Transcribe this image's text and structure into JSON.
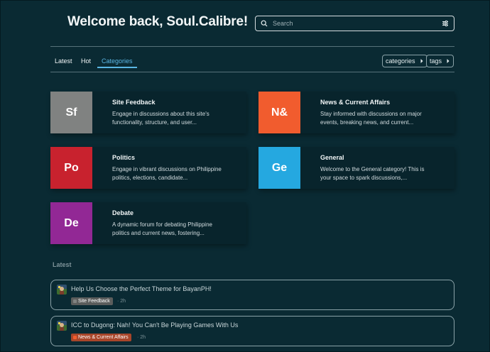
{
  "header": {
    "welcome": "Welcome back, Soul.Calibre!",
    "search_placeholder": "Search"
  },
  "nav": {
    "tabs": [
      {
        "label": "Latest",
        "active": false
      },
      {
        "label": "Hot",
        "active": false
      },
      {
        "label": "Categories",
        "active": true
      }
    ],
    "dropdowns": [
      {
        "label": "categories"
      },
      {
        "label": "tags"
      }
    ]
  },
  "categories": [
    {
      "abbr": "Sf",
      "name": "Site Feedback",
      "color": "#808281",
      "desc": "Engage in discussions about this site's functionality, structure, and user..."
    },
    {
      "abbr": "N&",
      "name": "News & Current Affairs",
      "color": "#f15c2e",
      "desc": "Stay informed with discussions on major events, breaking news, and current..."
    },
    {
      "abbr": "Po",
      "name": "Politics",
      "color": "#c8222e",
      "desc": "Engage in vibrant discussions on Philippine politics, elections, candidate..."
    },
    {
      "abbr": "Ge",
      "name": "General",
      "color": "#25a8e0",
      "desc": "Welcome to the General category! This is your space to spark discussions,..."
    },
    {
      "abbr": "De",
      "name": "Debate",
      "color": "#922895",
      "desc": "A dynamic forum for debating Philippine politics and current news, fostering..."
    }
  ],
  "latest": {
    "heading": "Latest",
    "topics": [
      {
        "title": "Help Us Choose the Perfect Theme for BayanPH!",
        "category": "Site Feedback",
        "category_color": "#808281",
        "age": "2h"
      },
      {
        "title": "ICC to Dugong: Nah! You Can't Be Playing Games With Us",
        "category": "News & Current Affairs",
        "category_color": "#f15c2e",
        "age": "2h"
      }
    ]
  }
}
